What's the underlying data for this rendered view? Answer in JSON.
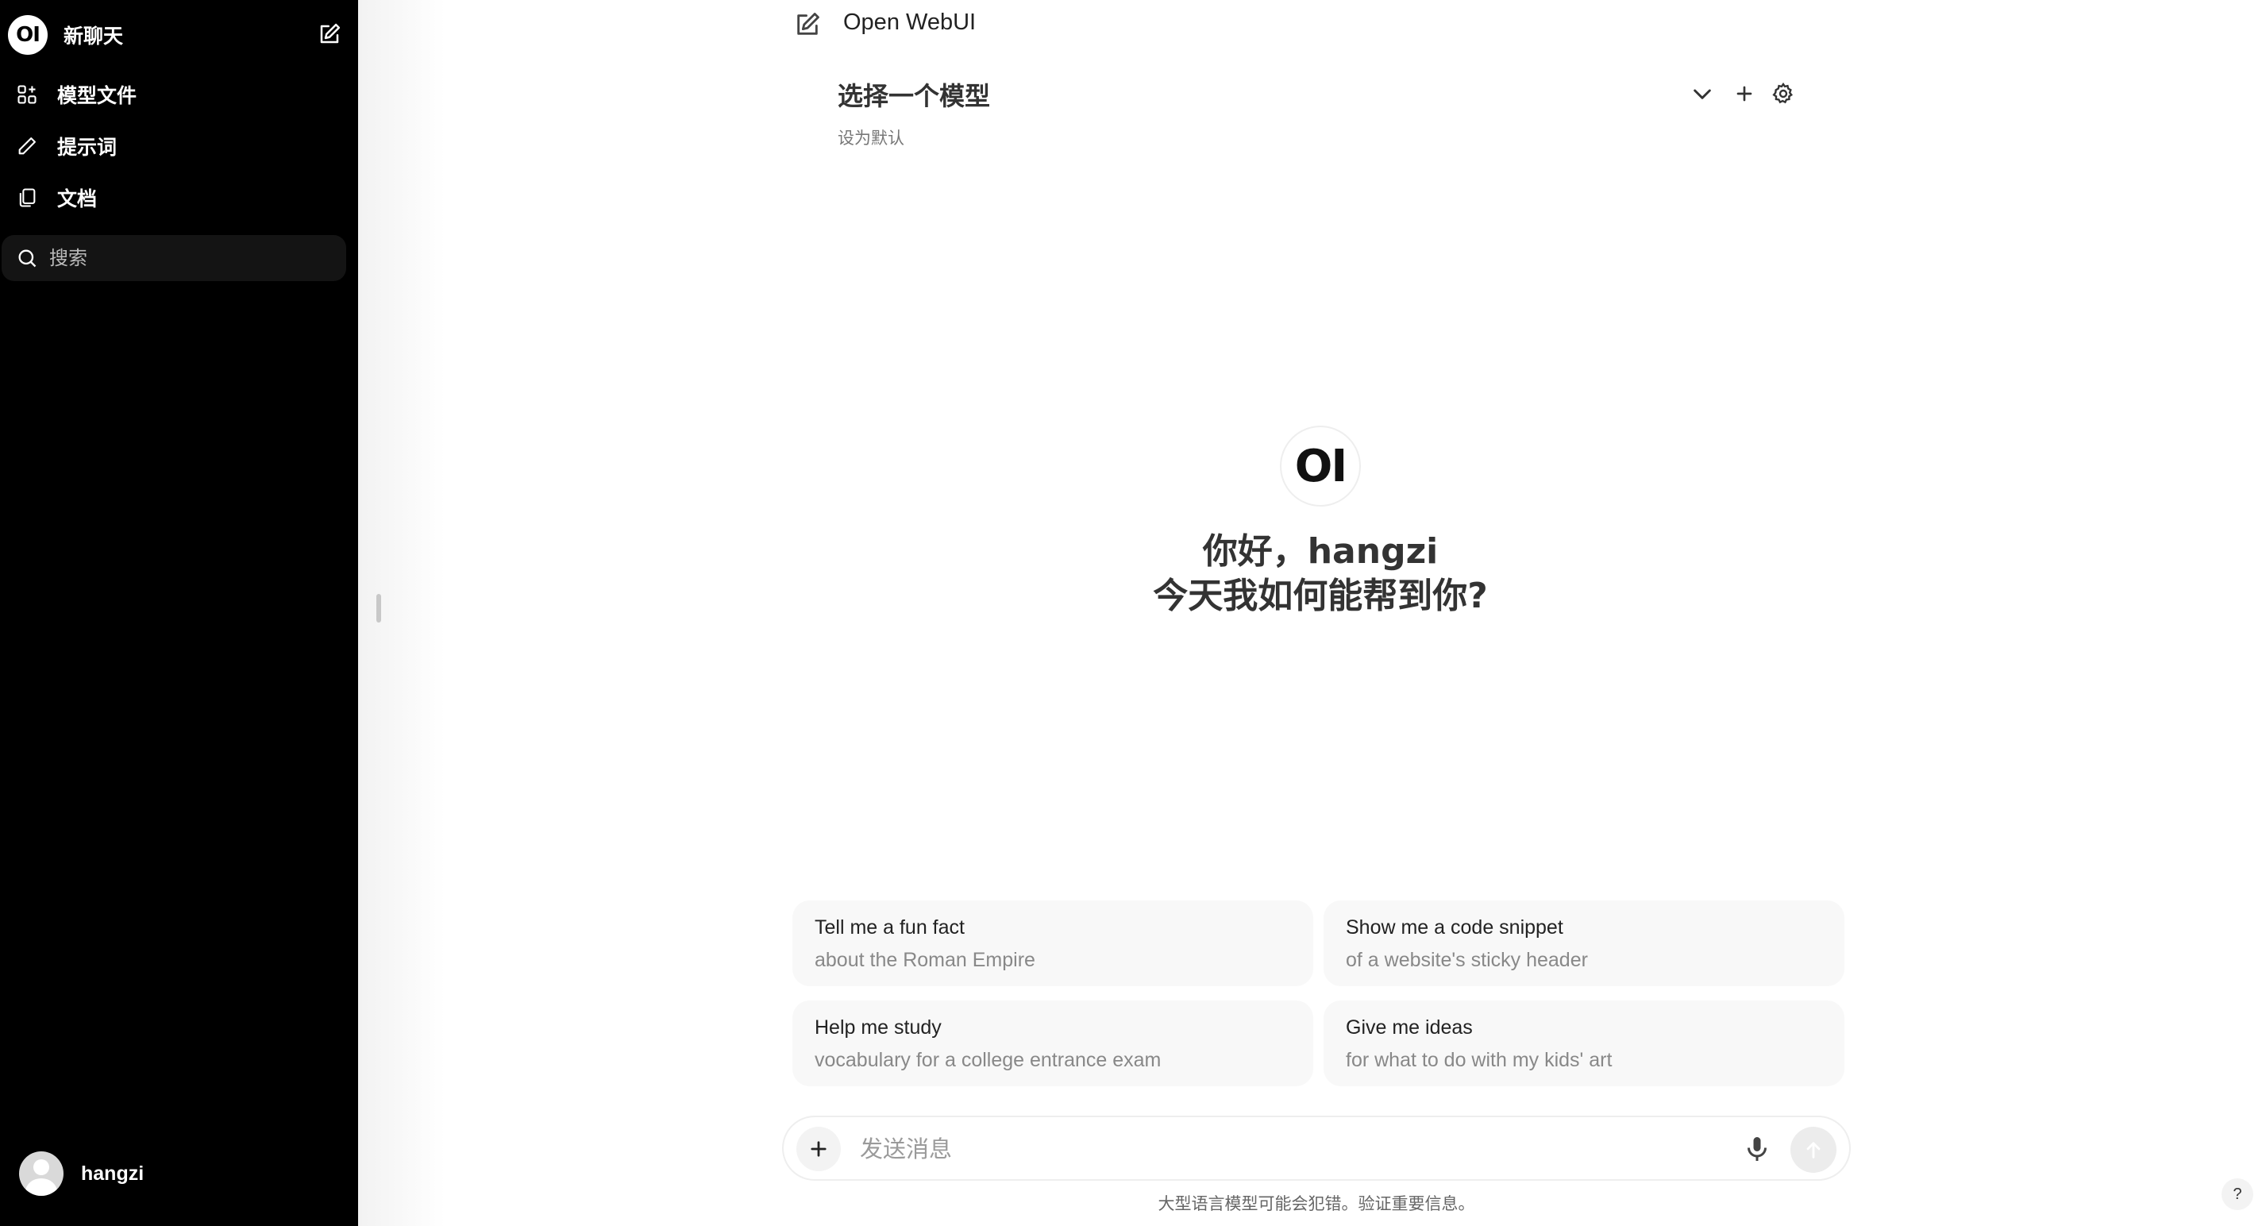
{
  "sidebar": {
    "logo_text": "OI",
    "new_chat_label": "新聊天",
    "items": [
      {
        "label": "模型文件",
        "icon": "grid-plus-icon"
      },
      {
        "label": "提示词",
        "icon": "pencil-icon"
      },
      {
        "label": "文档",
        "icon": "documents-icon"
      }
    ],
    "search_placeholder": "搜索",
    "user_name": "hangzi"
  },
  "header": {
    "app_title": "Open WebUI",
    "model_select_label": "选择一个模型",
    "set_default_label": "设为默认"
  },
  "center": {
    "logo_text": "OI",
    "greeting_line1": "你好，hangzi",
    "greeting_line2": "今天我如何能帮到你?"
  },
  "suggestions": [
    {
      "title": "Tell me a fun fact",
      "subtitle": "about the Roman Empire"
    },
    {
      "title": "Show me a code snippet",
      "subtitle": "of a website's sticky header"
    },
    {
      "title": "Help me study",
      "subtitle": "vocabulary for a college entrance exam"
    },
    {
      "title": "Give me ideas",
      "subtitle": "for what to do with my kids' art"
    }
  ],
  "composer": {
    "placeholder": "发送消息",
    "disclaimer": "大型语言模型可能会犯错。验证重要信息。"
  },
  "help_label": "?",
  "colors": {
    "sidebar_bg": "#000000",
    "card_bg": "#f8f8f8",
    "text_primary": "#333333"
  }
}
